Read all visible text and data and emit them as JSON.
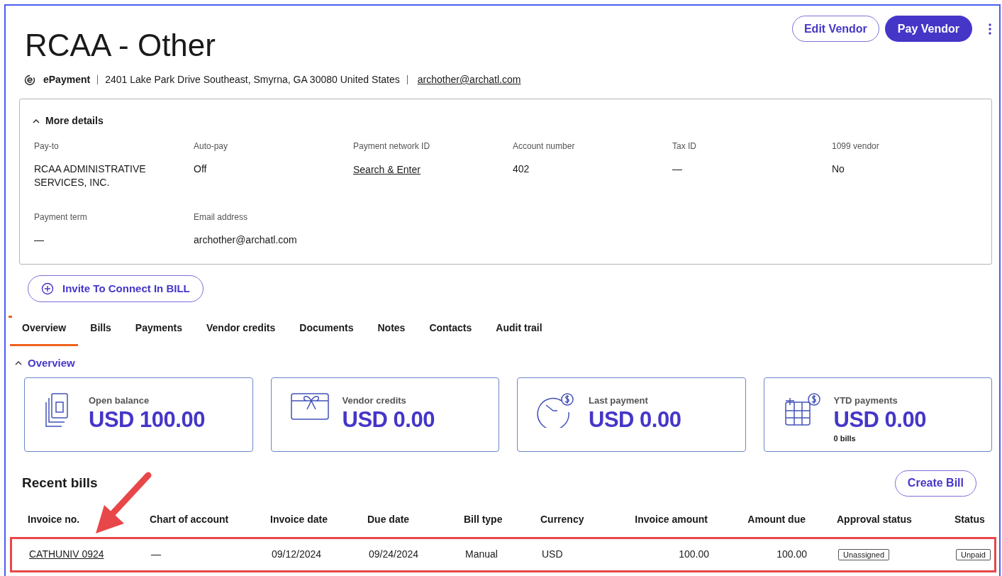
{
  "vendor": {
    "name": "RCAA - Other",
    "payment_method": "ePayment",
    "address": "2401 Lake Park Drive Southeast, Smyrna, GA 30080 United States",
    "email": "archother@archatl.com"
  },
  "actions": [
    {
      "label": "Edit Vendor",
      "kind": "outline"
    },
    {
      "label": "Pay Vendor",
      "kind": "primary"
    }
  ],
  "details": {
    "toggle": "More details",
    "expanded": true,
    "fields": [
      {
        "label": "Pay-to",
        "value": "RCAA ADMINISTRATIVE SERVICES, INC.",
        "kind": "text"
      },
      {
        "label": "Auto-pay",
        "value": "Off",
        "kind": "text"
      },
      {
        "label": "Payment network ID",
        "value": "Search & Enter",
        "kind": "link"
      },
      {
        "label": "Account number",
        "value": "402",
        "kind": "text"
      },
      {
        "label": "Tax ID",
        "value": "—",
        "kind": "text"
      },
      {
        "label": "1099 vendor",
        "value": "No",
        "kind": "text"
      },
      {
        "label": "Payment term",
        "value": "—",
        "kind": "text"
      },
      {
        "label": "Email address",
        "value": "archother@archatl.com",
        "kind": "text"
      }
    ]
  },
  "invite_button": "Invite To Connect In BILL",
  "tabs": [
    {
      "label": "Overview",
      "selected": true
    },
    {
      "label": "Bills",
      "selected": false
    },
    {
      "label": "Payments",
      "selected": false
    },
    {
      "label": "Vendor credits",
      "selected": false
    },
    {
      "label": "Documents",
      "selected": false
    },
    {
      "label": "Notes",
      "selected": false
    },
    {
      "label": "Contacts",
      "selected": false
    },
    {
      "label": "Audit trail",
      "selected": false
    }
  ],
  "overview": {
    "title": "Overview",
    "expanded": true,
    "cards": [
      {
        "kind": "documents",
        "label": "Open balance",
        "amount": "USD 100.00"
      },
      {
        "kind": "gift",
        "label": "Vendor credits",
        "amount": "USD 0.00"
      },
      {
        "kind": "clock",
        "label": "Last payment",
        "amount": "USD 0.00"
      },
      {
        "kind": "calendar",
        "label": "YTD payments",
        "amount": "USD 0.00",
        "note": "0 bills"
      }
    ]
  },
  "recent_bills": {
    "title": "Recent bills",
    "create_button": "Create Bill",
    "columns": [
      "Invoice no.",
      "Chart of account",
      "Invoice date",
      "Due date",
      "Bill type",
      "Currency",
      "Invoice amount",
      "Amount due",
      "Approval status",
      "Status"
    ],
    "rows": [
      {
        "invoice_no": "CATHUNIV 0924",
        "chart_of_account": "—",
        "invoice_date": "09/12/2024",
        "due_date": "09/24/2024",
        "bill_type": "Manual",
        "currency": "USD",
        "invoice_amount": "100.00",
        "amount_due": "100.00",
        "approval_status": "Unassigned",
        "status": "Unpaid",
        "highlighted": true
      }
    ]
  }
}
